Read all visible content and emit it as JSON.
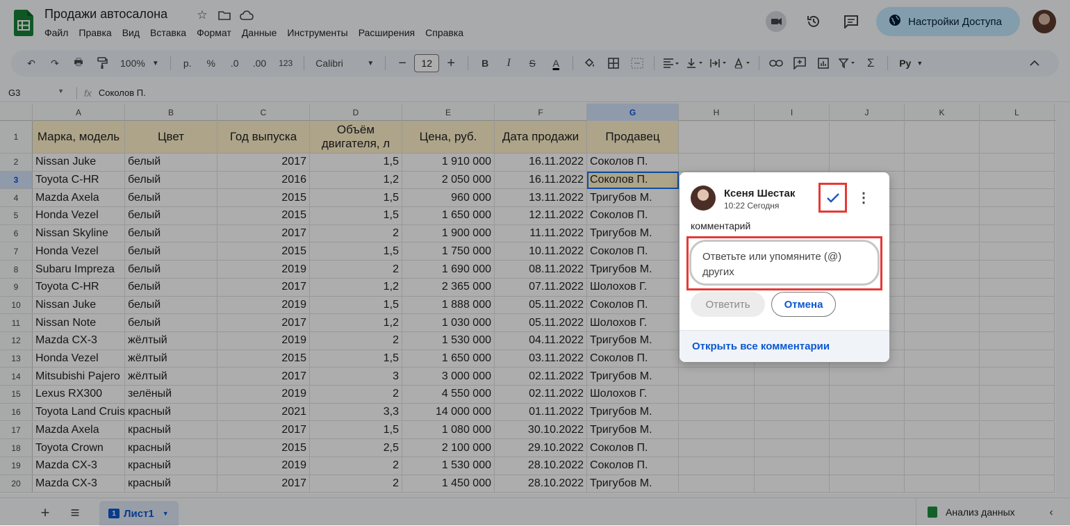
{
  "header": {
    "doc_title": "Продажи автосалона",
    "menu": [
      "Файл",
      "Правка",
      "Вид",
      "Вставка",
      "Формат",
      "Данные",
      "Инструменты",
      "Расширения",
      "Справка"
    ],
    "share_label": "Настройки Доступа"
  },
  "toolbar": {
    "zoom": "100%",
    "currency": "р.",
    "percent": "%",
    "dec_decrease": ".0",
    "dec_increase": ".00",
    "number_format": "123",
    "font": "Calibri",
    "font_size": "12",
    "input_tools": "Ру"
  },
  "formula_bar": {
    "cell_ref": "G3",
    "value": "Соколов П."
  },
  "grid": {
    "columns": [
      "A",
      "B",
      "C",
      "D",
      "E",
      "F",
      "G",
      "H",
      "I",
      "J",
      "K",
      "L"
    ],
    "selected_column": "G",
    "selected_row": "3",
    "header_row": [
      "Марка, модель",
      "Цвет",
      "Год выпуска",
      "Объём двигателя, л",
      "Цена, руб.",
      "Дата продажи",
      "Продавец"
    ],
    "rows": [
      [
        "Nissan Juke",
        "белый",
        "2017",
        "1,5",
        "1 910 000",
        "16.11.2022",
        "Соколов П."
      ],
      [
        "Toyota C-HR",
        "белый",
        "2016",
        "1,2",
        "2 050 000",
        "16.11.2022",
        "Соколов П."
      ],
      [
        "Mazda Axela",
        "белый",
        "2015",
        "1,5",
        "960 000",
        "13.11.2022",
        "Тригубов М."
      ],
      [
        "Honda Vezel",
        "белый",
        "2015",
        "1,5",
        "1 650 000",
        "12.11.2022",
        "Соколов П."
      ],
      [
        "Nissan Skyline",
        "белый",
        "2017",
        "2",
        "1 900 000",
        "11.11.2022",
        "Тригубов М."
      ],
      [
        "Honda Vezel",
        "белый",
        "2015",
        "1,5",
        "1 750 000",
        "10.11.2022",
        "Соколов П."
      ],
      [
        "Subaru Impreza",
        "белый",
        "2019",
        "2",
        "1 690 000",
        "08.11.2022",
        "Тригубов М."
      ],
      [
        "Toyota C-HR",
        "белый",
        "2017",
        "1,2",
        "2 365 000",
        "07.11.2022",
        "Шолохов Г."
      ],
      [
        "Nissan Juke",
        "белый",
        "2019",
        "1,5",
        "1 888 000",
        "05.11.2022",
        "Соколов П."
      ],
      [
        "Nissan Note",
        "белый",
        "2017",
        "1,2",
        "1 030 000",
        "05.11.2022",
        "Шолохов Г."
      ],
      [
        "Mazda CX-3",
        "жёлтый",
        "2019",
        "2",
        "1 530 000",
        "04.11.2022",
        "Тригубов М."
      ],
      [
        "Honda Vezel",
        "жёлтый",
        "2015",
        "1,5",
        "1 650 000",
        "03.11.2022",
        "Соколов П."
      ],
      [
        "Mitsubishi Pajero",
        "жёлтый",
        "2017",
        "3",
        "3 000 000",
        "02.11.2022",
        "Тригубов М."
      ],
      [
        "Lexus RX300",
        "зелёный",
        "2019",
        "2",
        "4 550 000",
        "02.11.2022",
        "Шолохов Г."
      ],
      [
        "Toyota Land Cruiser",
        "красный",
        "2021",
        "3,3",
        "14 000 000",
        "01.11.2022",
        "Тригубов М."
      ],
      [
        "Mazda Axela",
        "красный",
        "2017",
        "1,5",
        "1 080 000",
        "30.10.2022",
        "Тригубов М."
      ],
      [
        "Toyota Crown",
        "красный",
        "2015",
        "2,5",
        "2 100 000",
        "29.10.2022",
        "Соколов П."
      ],
      [
        "Mazda CX-3",
        "красный",
        "2019",
        "2",
        "1 530 000",
        "28.10.2022",
        "Соколов П."
      ],
      [
        "Mazda CX-3",
        "красный",
        "2017",
        "2",
        "1 450 000",
        "28.10.2022",
        "Тригубов М."
      ]
    ]
  },
  "bottom_bar": {
    "sheet_num": "1",
    "sheet_name": "Лист1",
    "explore_label": "Анализ данных"
  },
  "comment": {
    "author": "Ксеня Шестак",
    "time": "10:22 Сегодня",
    "text": "комментарий",
    "reply_placeholder": "Ответьте или упомяните (@) других",
    "reply_label": "Ответить",
    "cancel_label": "Отмена",
    "open_all_label": "Открыть все комментарии"
  }
}
